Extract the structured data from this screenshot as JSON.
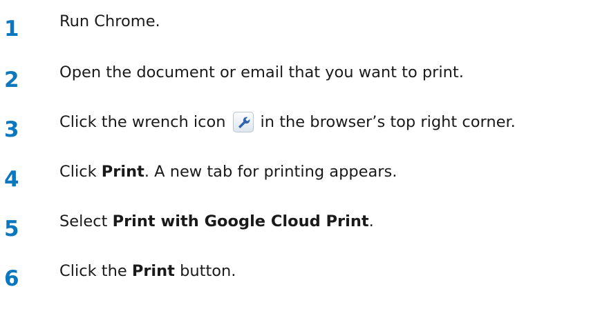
{
  "steps": [
    {
      "number": "1",
      "text": "Run Chrome."
    },
    {
      "number": "2",
      "text": "Open the document or email that you want to print."
    },
    {
      "number": "3",
      "text_before": "Click the wrench icon",
      "icon": "wrench-icon",
      "text_after": "in the browser’s top right corner."
    },
    {
      "number": "4",
      "text_before": "Click ",
      "bold": "Print",
      "text_after": ". A new tab for printing appears."
    },
    {
      "number": "5",
      "text_before": "Select ",
      "bold": "Print with Google Cloud Print",
      "text_after": "."
    },
    {
      "number": "6",
      "text_before": "Click the ",
      "bold": "Print",
      "text_after": " button."
    }
  ],
  "colors": {
    "step_number": "#0b77bf",
    "body_text": "#1a1a1a",
    "icon_button_border": "#b9c4cf",
    "icon_blue": "#2f64a8"
  }
}
